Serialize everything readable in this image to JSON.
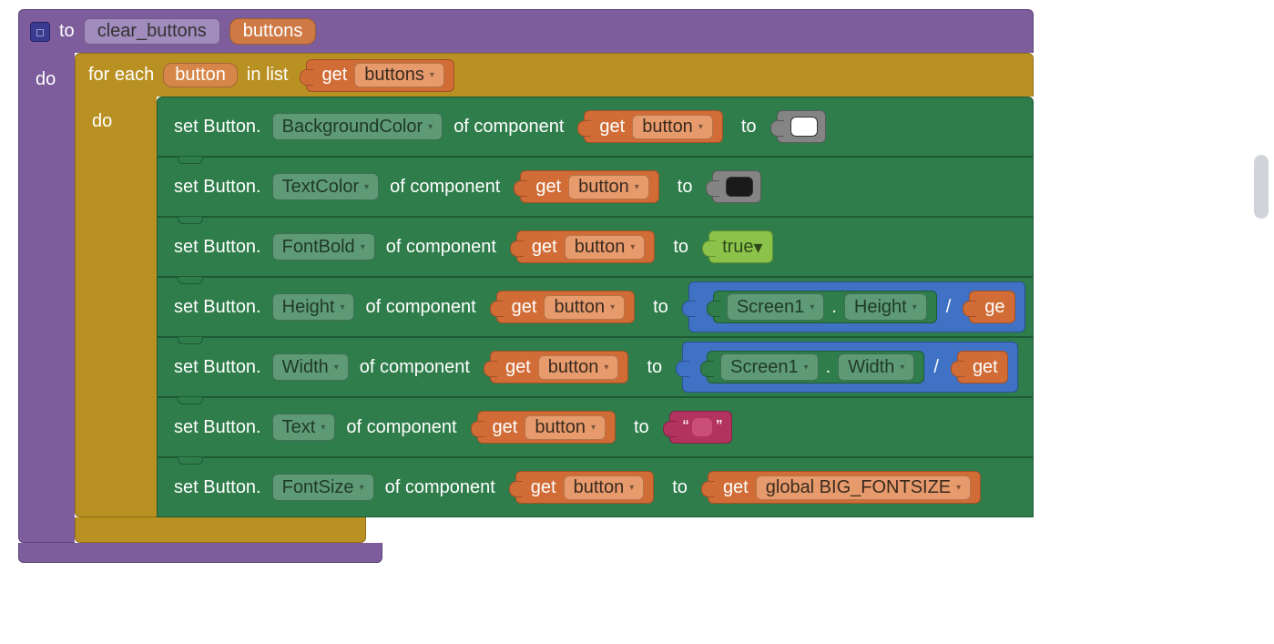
{
  "procedure": {
    "to_label": "to",
    "name": "clear_buttons",
    "param": "buttons",
    "do_label": "do"
  },
  "foreach": {
    "prefix": "for each",
    "var": "button",
    "inlist": "in list",
    "get_label": "get",
    "list_field": "buttons",
    "do_label": "do"
  },
  "common": {
    "set_prefix": "set Button.",
    "of_component": "of component",
    "to_label": "to",
    "get_label": "get",
    "var_button": "button"
  },
  "rows": [
    {
      "property": "BackgroundColor",
      "value": {
        "type": "color",
        "color": "#ffffff"
      }
    },
    {
      "property": "TextColor",
      "value": {
        "type": "color",
        "color": "#1a1a1a"
      }
    },
    {
      "property": "FontBold",
      "value": {
        "type": "bool",
        "label": "true"
      }
    },
    {
      "property": "Height",
      "value": {
        "type": "math",
        "screen": "Screen1",
        "screen_prop": "Height",
        "op": "/",
        "right_get": "ge"
      }
    },
    {
      "property": "Width",
      "value": {
        "type": "math",
        "screen": "Screen1",
        "screen_prop": "Width",
        "op": "/",
        "right_get": "get"
      }
    },
    {
      "property": "Text",
      "value": {
        "type": "text",
        "content": ""
      }
    },
    {
      "property": "FontSize",
      "value": {
        "type": "getvar",
        "var": "global BIG_FONTSIZE"
      }
    }
  ]
}
